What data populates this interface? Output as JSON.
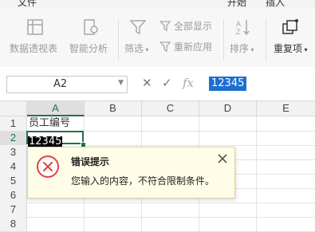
{
  "menu": {
    "items": [
      "文件",
      "开始",
      "插入"
    ]
  },
  "ribbon": {
    "pivot_label": "数据透视表",
    "smart_label": "智能分析",
    "filter_label": "筛选",
    "show_all_label": "全部显示",
    "reapply_label": "重新应用",
    "sort_label": "排序",
    "duplicate_label": "重复项"
  },
  "formula_bar": {
    "name_box": "A2",
    "fx": "fx",
    "content": "12345"
  },
  "grid": {
    "columns": [
      "A",
      "B",
      "C",
      "D",
      "E"
    ],
    "rows": [
      "1",
      "2",
      "3",
      "4",
      "5",
      "6",
      "7",
      "8"
    ],
    "a1": "员工编号",
    "a2": "12345"
  },
  "error_dialog": {
    "title": "错误提示",
    "message": "您输入的内容，不符合限制条件。"
  },
  "colors": {
    "accent": "#217346",
    "error": "#e04343",
    "selection": "#1e6fd0"
  }
}
